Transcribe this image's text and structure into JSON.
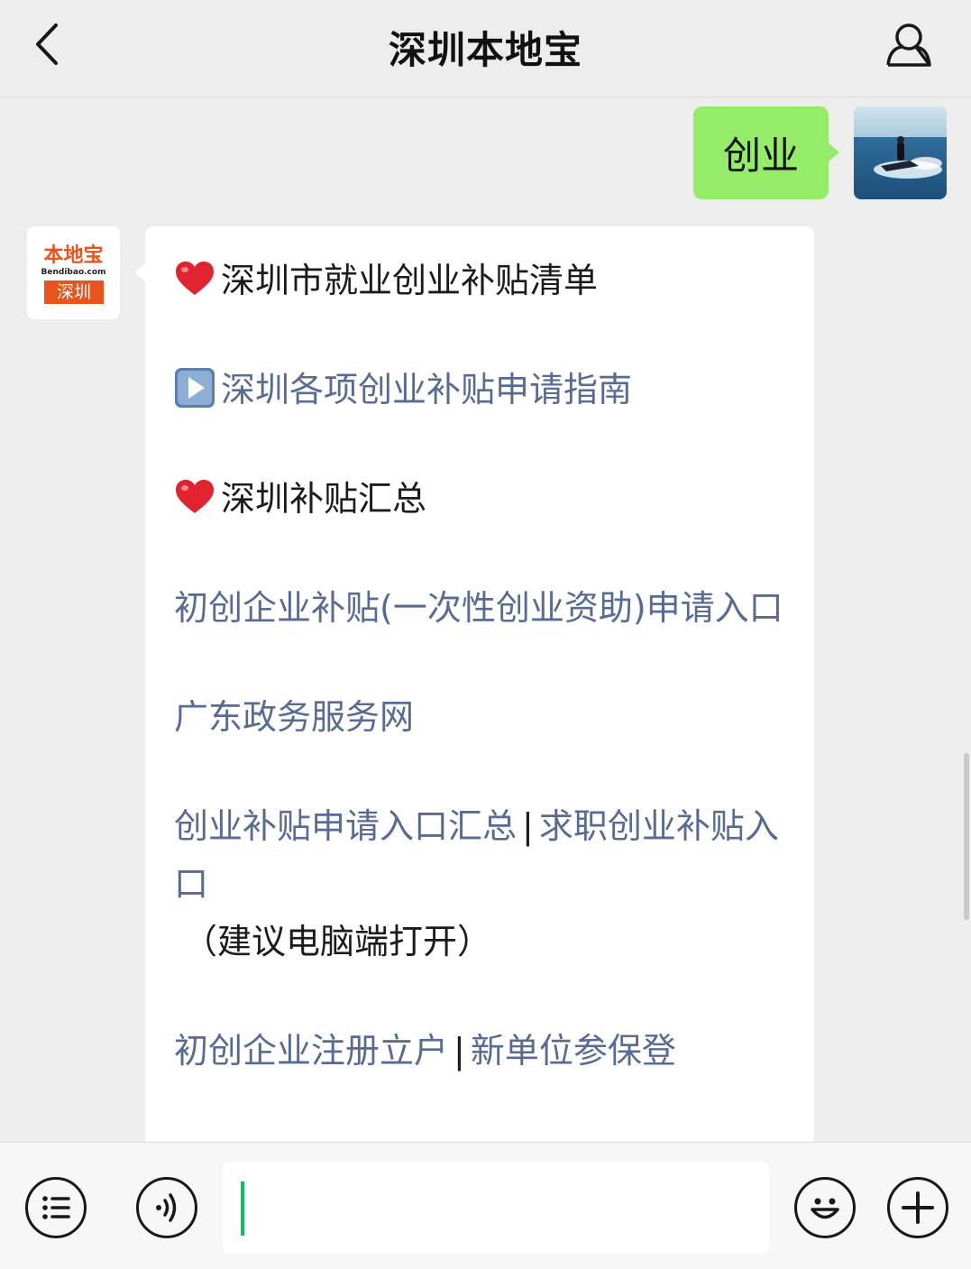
{
  "header": {
    "title": "深圳本地宝",
    "back_icon": "chevron-left-icon",
    "profile_icon": "person-icon"
  },
  "outgoing": {
    "text": "创业",
    "bubble_color": "#95ec69"
  },
  "bot_avatar": {
    "logo_text": "本地宝",
    "logo_sub": "Bendibao.com",
    "logo_city": "深圳",
    "brand_color": "#e8541c"
  },
  "incoming": {
    "item1": {
      "icon": "red-heart-icon",
      "text": "深圳市就业创业补贴清单"
    },
    "item2": {
      "icon": "play-button-icon",
      "link": "深圳各项创业补贴申请指南"
    },
    "item3": {
      "icon": "red-heart-icon",
      "text": "深圳补贴汇总"
    },
    "item4": {
      "link": "初创企业补贴(一次性创业资助)申请入口"
    },
    "item5": {
      "link": "广东政务服务网"
    },
    "item6": {
      "link_a": "创业补贴申请入口汇总",
      "separator": "|",
      "link_b": "求职创业补贴入口",
      "note": "（建议电脑端打开）"
    },
    "item7": {
      "link_a": "初创企业注册立户",
      "separator": "|",
      "link_b": "新单位参保登"
    },
    "link_color": "#576b95"
  },
  "input_bar": {
    "menu_icon": "list-menu-icon",
    "voice_icon": "voice-icon",
    "emoji_icon": "smiley-icon",
    "plus_icon": "plus-icon",
    "input_value": ""
  }
}
